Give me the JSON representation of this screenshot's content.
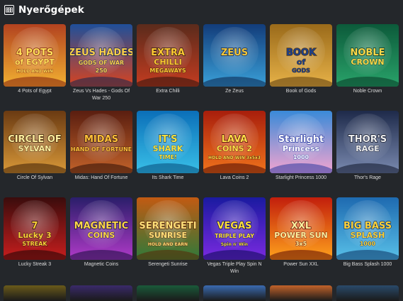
{
  "section": {
    "title": "Nyerőgépek",
    "icon": "slot-machine-icon"
  },
  "games": [
    {
      "name": "4 Pots of Egypt",
      "art": [
        "4 POTS",
        "of EGYPT",
        "HOLD AND WIN"
      ],
      "bg": [
        "#b2421f",
        "#f2b132"
      ],
      "fg": "#ffe25a",
      "accent": "#7b1c0d"
    },
    {
      "name": "Zeus Vs Hades - Gods Of War 250",
      "art": [
        "ZEUS HADES",
        "GODS OF WAR",
        "250"
      ],
      "bg": [
        "#1f4f9a",
        "#d8431f"
      ],
      "fg": "#ffd04a",
      "accent": "#0e2450"
    },
    {
      "name": "Extra Chilli",
      "art": [
        "EXTRA",
        "CHILLI",
        "MEGAWAYS"
      ],
      "bg": [
        "#5a2b1c",
        "#c43c20"
      ],
      "fg": "#ffcc33",
      "accent": "#2a130c"
    },
    {
      "name": "Ze Zeus",
      "art": [
        "ZEUS",
        "",
        ""
      ],
      "bg": [
        "#123c7a",
        "#3aa0d8"
      ],
      "fg": "#f6c83a",
      "accent": "#0a2048"
    },
    {
      "name": "Book of Gods",
      "art": [
        "BOOK",
        "of",
        "GODS"
      ],
      "bg": [
        "#9a6a1a",
        "#e7b248"
      ],
      "fg": "#1c3f8a",
      "accent": "#5a3a0c"
    },
    {
      "name": "Noble Crown",
      "art": [
        "NOBLE",
        "CROWN",
        ""
      ],
      "bg": [
        "#0c5a3a",
        "#29a36a"
      ],
      "fg": "#ffd94a",
      "accent": "#063522"
    },
    {
      "name": "Circle Of Sylvan",
      "art": [
        "CIRCLE OF",
        "SYLVAN",
        ""
      ],
      "bg": [
        "#6a3a12",
        "#d89838"
      ],
      "fg": "#fff0a0",
      "accent": "#3a1e06"
    },
    {
      "name": "Midas: Hand Of Fortune",
      "art": [
        "MIDAS",
        "HAND OF FORTUNE",
        ""
      ],
      "bg": [
        "#5a1e10",
        "#c2622a"
      ],
      "fg": "#ffc23a",
      "accent": "#2a0c06"
    },
    {
      "name": "Its Shark Time",
      "art": [
        "IT'S",
        "SHARK",
        "TIME!"
      ],
      "bg": [
        "#0b6fb8",
        "#39c0e8"
      ],
      "fg": "#ffe23a",
      "accent": "#064878"
    },
    {
      "name": "Lava Coins 2",
      "art": [
        "LAVA",
        "COINS 2",
        "HOLD AND WIN 3x5x3"
      ],
      "bg": [
        "#a81e0c",
        "#f0731c"
      ],
      "fg": "#ffe04a",
      "accent": "#4a0a04"
    },
    {
      "name": "Starlight Princess 1000",
      "art": [
        "Starlight",
        "Princess",
        "1000"
      ],
      "bg": [
        "#3a8ad8",
        "#f2a4d0"
      ],
      "fg": "#ffffff",
      "accent": "#2a3aa0"
    },
    {
      "name": "Thor's Rage",
      "art": [
        "THOR'S",
        "RAGE",
        ""
      ],
      "bg": [
        "#1e2a4a",
        "#7a8ab0"
      ],
      "fg": "#f0f0f0",
      "accent": "#0c1226"
    },
    {
      "name": "Lucky Streak 3",
      "art": [
        "7",
        "Lucky 3",
        "STREAK"
      ],
      "bg": [
        "#3a0c0c",
        "#c81e1e"
      ],
      "fg": "#ffd23a",
      "accent": "#1a0404"
    },
    {
      "name": "Magnetic Coins",
      "art": [
        "MAGNETIC",
        "COINS",
        ""
      ],
      "bg": [
        "#2a1e6a",
        "#b03ac8"
      ],
      "fg": "#ffd84a",
      "accent": "#140c38"
    },
    {
      "name": "Serengeti Sunrise",
      "art": [
        "SERENGETI",
        "SUNRISE",
        "HOLD AND EARN"
      ],
      "bg": [
        "#c25a12",
        "#2e7a3a"
      ],
      "fg": "#ffe07a",
      "accent": "#5a2606"
    },
    {
      "name": "Vegas Triple Play Spin N Win",
      "art": [
        "VEGAS",
        "TRIPLE PLAY",
        "Spin n' Win"
      ],
      "bg": [
        "#1a1aa0",
        "#7a2ae0"
      ],
      "fg": "#ffe03a",
      "accent": "#0a0a50"
    },
    {
      "name": "Power Sun XXL",
      "art": [
        "XXL",
        "POWER SUN",
        "3x5"
      ],
      "bg": [
        "#c21e0c",
        "#ffa21c"
      ],
      "fg": "#fff3a0",
      "accent": "#5a0a04"
    },
    {
      "name": "Big Bass Splash 1000",
      "art": [
        "BIG BASS",
        "SPLASH",
        "1000"
      ],
      "bg": [
        "#1e6ab0",
        "#58c0e8"
      ],
      "fg": "#ffd23a",
      "accent": "#0a3060"
    }
  ],
  "partial_row_colors": [
    "#6a5a1a",
    "#3a2a6a",
    "#1a5a3a",
    "#3a6ab0",
    "#c2622a",
    "#2a4a6a"
  ]
}
